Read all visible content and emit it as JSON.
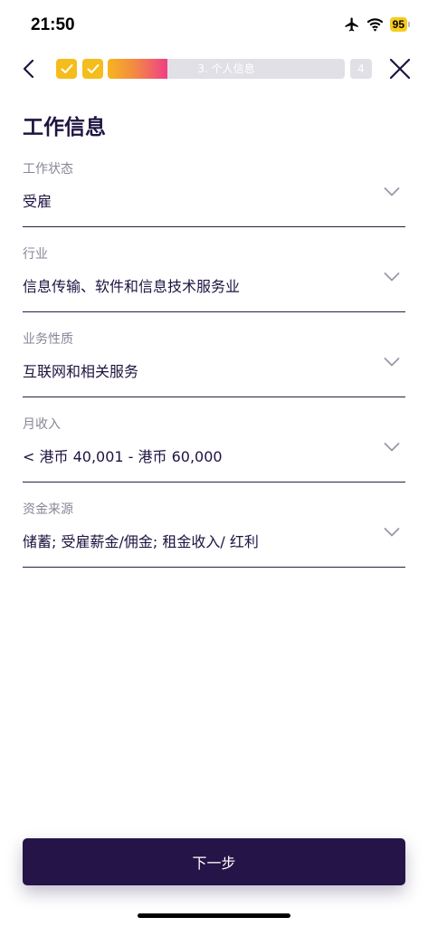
{
  "status_bar": {
    "time": "21:50",
    "battery": "95"
  },
  "progress": {
    "current_step_label": "3. 个人信息",
    "next_step_number": "4",
    "current_step_fill": 0.25
  },
  "page": {
    "title": "工作信息"
  },
  "fields": [
    {
      "label": "工作状态",
      "value": "受雇"
    },
    {
      "label": "行业",
      "value": "信息传输、软件和信息技术服务业"
    },
    {
      "label": "业务性质",
      "value": "互联网和相关服务"
    },
    {
      "label": "月收入",
      "value": "< 港币 40,001 - 港币 60,000"
    },
    {
      "label": "资金来源",
      "value": "储蓄; 受雇薪金/佣金; 租金收入/ 红利"
    }
  ],
  "actions": {
    "next_label": "下一步"
  },
  "colors": {
    "brand_dark": "#251447",
    "step_done": "#f5bd1c",
    "step_pending": "#e0e0e6"
  },
  "icons": {
    "back": "chevron-left-icon",
    "close": "close-icon",
    "step_done": "check-icon",
    "field": "chevron-down-icon",
    "status": [
      "airplane-icon",
      "wifi-icon",
      "battery-icon"
    ]
  }
}
